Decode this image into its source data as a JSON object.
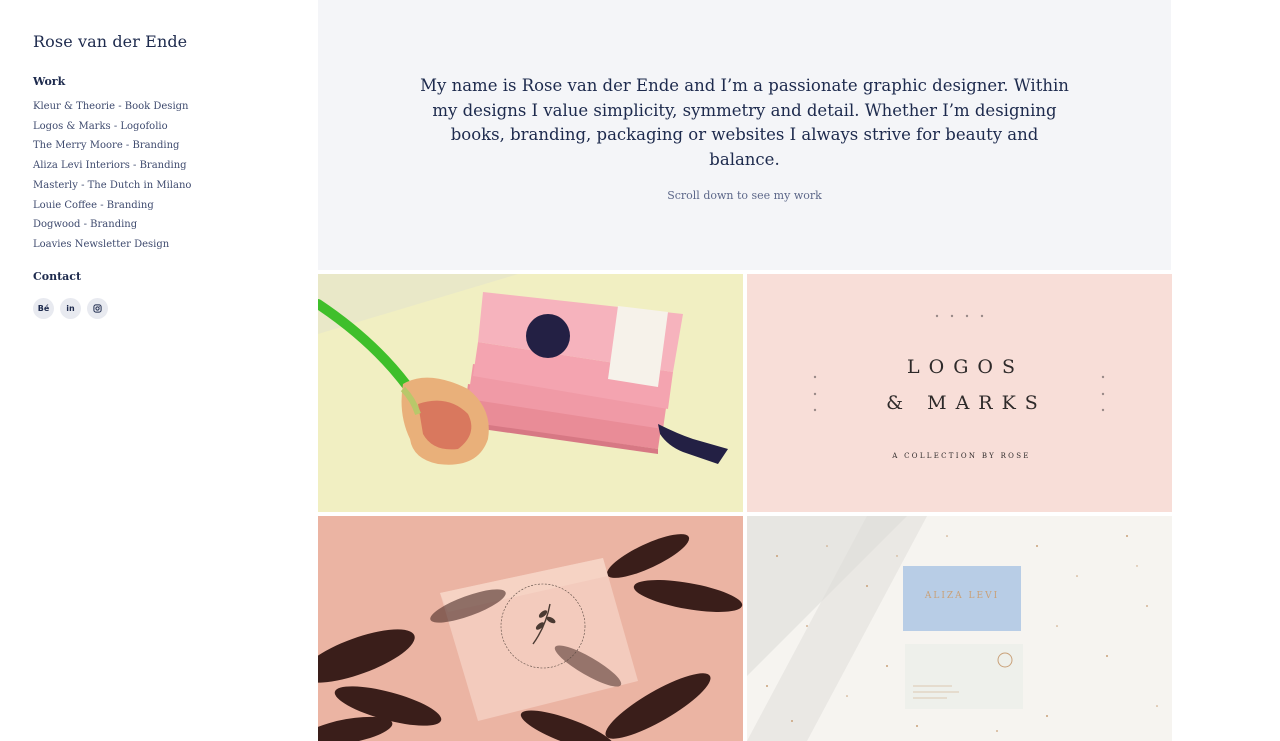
{
  "site": {
    "name": "Rose van der Ende"
  },
  "sidebar": {
    "work_title": "Work",
    "items": [
      {
        "label": "Kleur & Theorie - Book Design"
      },
      {
        "label": "Logos & Marks - Logofolio"
      },
      {
        "label": "The Merry Moore - Branding"
      },
      {
        "label": "Aliza Levi Interiors - Branding"
      },
      {
        "label": "Masterly - The Dutch in Milano"
      },
      {
        "label": "Louie Coffee - Branding"
      },
      {
        "label": "Dogwood - Branding"
      },
      {
        "label": "Loavies Newsletter Design"
      }
    ],
    "contact_title": "Contact",
    "social": [
      {
        "label": "Bé",
        "icon": "behance-icon"
      },
      {
        "label": "in",
        "icon": "linkedin-icon"
      },
      {
        "label": "◎",
        "icon": "instagram-icon"
      }
    ]
  },
  "hero": {
    "text": "My name is Rose van der Ende and I’m a passionate graphic designer. Within my designs I value simplicity,  symmetry and detail. Whether I’m designing books, branding, packaging or websites I always strive for beauty and balance.",
    "scroll_hint": "Scroll down to see my work"
  },
  "tiles": {
    "logos": {
      "line1": "LOGOS",
      "line2": "& MARKS",
      "subtitle": "A COLLECTION BY ROSE"
    },
    "aliza": {
      "card_text": "ALIZA LEVI"
    }
  },
  "colors": {
    "navy": "#1d2a4d",
    "hero_bg": "#f4f5f8",
    "pink": "#f3a8b4",
    "peach": "#eab2a2"
  }
}
